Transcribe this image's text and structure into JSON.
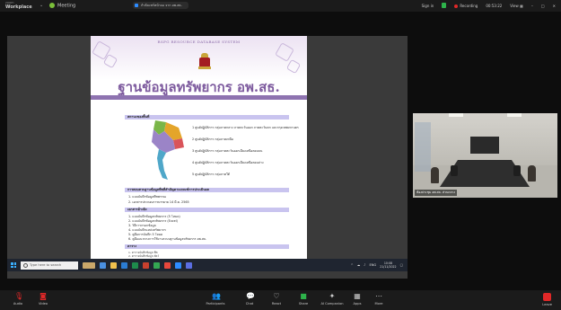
{
  "topbar": {
    "brand": "Workplace",
    "brand_sub": "zoom",
    "meeting_label": "Meeting",
    "share_tab": "กำลังแชร์หน้าจอ จาก อพ.สธ.",
    "sign_in": "Sign in",
    "recording": "Recording",
    "timer": "00:53:22",
    "view": "View"
  },
  "document": {
    "system_title": "RSPG RESOURCE DATABASE SYSTEM",
    "big_title": "ฐานข้อมูลทรัพยากร อพ.สธ.",
    "sections": [
      {
        "heading": "สถานะของพื้นที่",
        "lines": [
          "1 ศูนย์ปฏิบัติการ กลุ่มภาคกลาง ภาคตะวันออก ภาคตะวันตก และกรุงเทพมหานคร",
          "2 ศูนย์ปฏิบัติการ กลุ่มภาคเหนือ",
          "3 ศูนย์ปฏิบัติการ กลุ่มภาคตะวันออกเฉียงเหนือตอนบน",
          "4 ศูนย์ปฏิบัติการ กลุ่มภาคตะวันออกเฉียงเหนือตอนล่าง",
          "5 ศูนย์ปฏิบัติการ กลุ่มภาคใต้"
        ]
      },
      {
        "heading": "การสอบสวนฐานข้อมูลพืชที่สำคัญตามเกณฑ์การประเมินผล",
        "lines": [
          "1. แบบบันทึกข้อมูลพืชพรรณ",
          "2. เอกสารประกอบการบรรยาย 14 มี.ค. 2565"
        ]
      },
      {
        "heading": "เอกสารอ้างอิง",
        "lines": [
          "1. แบบบันทึกข้อมูลทรัพยากร (5 โหมด)",
          "2. แบบบันทึกข้อมูลทรัพยากร (Excel)",
          "3. วิธีการกรอกข้อมูล",
          "4. แบบบันทึกแหล่งทรัพยากร",
          "5. คู่มือการบันทึก 5 โหมด",
          "6. คู่มือแนวทางการใช้งานระบบฐานข้อมูลทรัพยากร อพ.สธ."
        ]
      },
      {
        "heading": "ตาราง",
        "lines": [
          "1. ตารางบันทึกข้อมูล พืช",
          "2. ตารางบันทึกข้อมูล สัตว์"
        ]
      }
    ]
  },
  "video": {
    "participant_name": "ห้องประชุม อพ.สธ. ส่วนกลาง"
  },
  "taskbar": {
    "search_placeholder": "Type here to search",
    "lang": "ENG",
    "time": "10:08",
    "date": "21/11/2022"
  },
  "toolbar": {
    "audio": "Audio",
    "video": "Video",
    "participants": "Participants",
    "chat": "Chat",
    "react": "React",
    "share": "Share",
    "ai_companion": "AI Companion",
    "apps": "Apps",
    "more": "More",
    "leave": "Leave",
    "participant_count": "1"
  },
  "colors": {
    "accent_purple": "#7d5a9e",
    "section_bar": "#c9c4ef",
    "leave_red": "#e02828",
    "share_green": "#2eb34b"
  }
}
